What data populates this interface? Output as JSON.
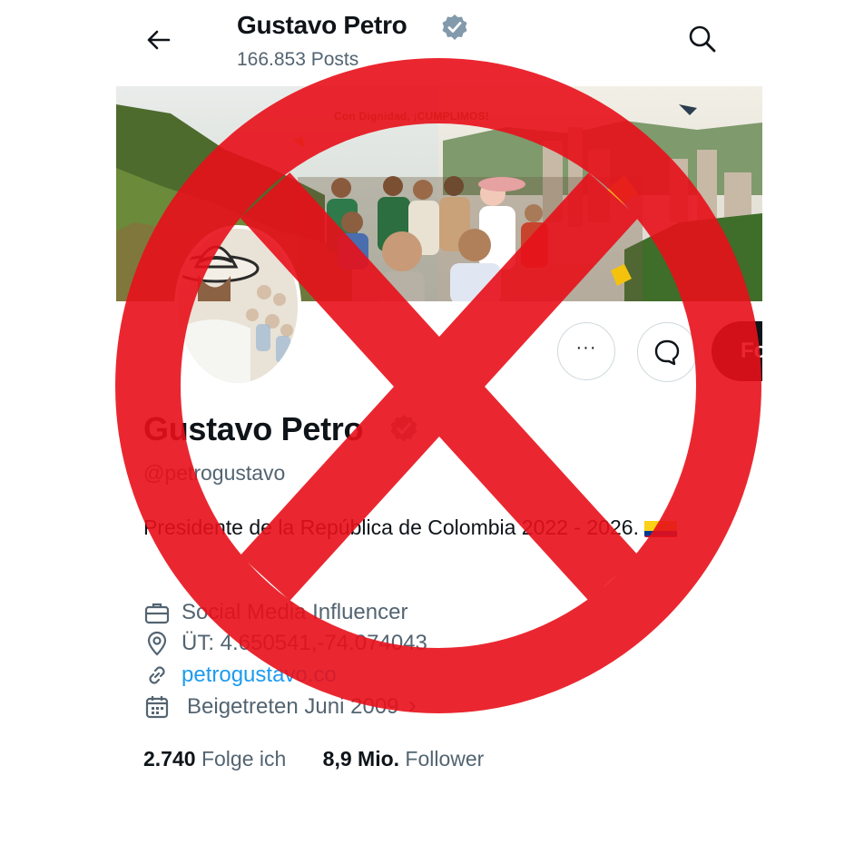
{
  "header": {
    "name": "Gustavo Petro",
    "posts_count": "166.853 Posts"
  },
  "banner": {
    "text": "Con Dignidad, ¡CUMPLIMOS!"
  },
  "actions": {
    "more_label": "···",
    "follow_label": "Folgen"
  },
  "profile": {
    "name": "Gustavo Petro",
    "handle": "@petrogustavo",
    "bio": "Presidente de la República de Colombia 2022 - 2026.",
    "occupation": "Social Media Influencer",
    "location": "ÜT: 4.650541,-74.074043",
    "website": "petrogustavo.co",
    "joined": "Beigetreten Juni 2009",
    "joined_chevron": "›"
  },
  "stats": {
    "following_count": "2.740",
    "following_label": "Folge ich",
    "followers_count": "8,9 Mio.",
    "followers_label": "Follower"
  },
  "icons": [
    "back-arrow-icon",
    "search-icon",
    "verified-badge-icon",
    "more-icon",
    "message-icon",
    "briefcase-icon",
    "location-pin-icon",
    "link-icon",
    "calendar-icon",
    "colombia-flag-icon",
    "prohibition-icon"
  ],
  "colors": {
    "overlay_red": "#e8101a",
    "link_blue": "#1d9bf0",
    "verified_gray": "#829aab",
    "follow_button": "#0f1419",
    "secondary_text": "#536471"
  }
}
